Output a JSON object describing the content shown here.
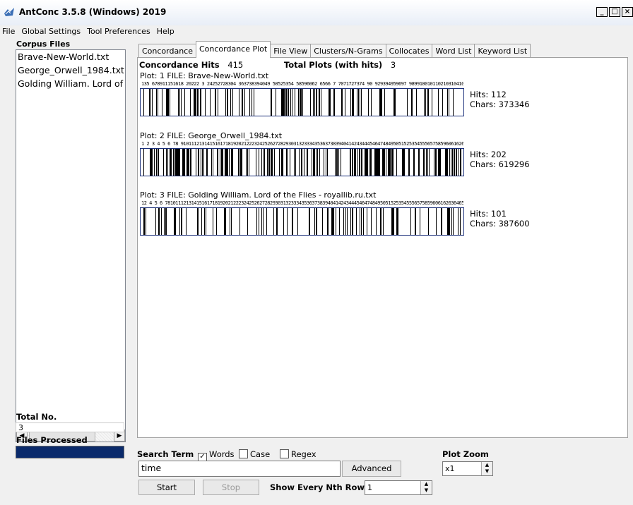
{
  "window": {
    "title": "AntConc 3.5.8 (Windows) 2019",
    "buttons": [
      "_",
      "□",
      "×"
    ]
  },
  "menu": [
    "File",
    "Global Settings",
    "Tool Preferences",
    "Help"
  ],
  "corpus": {
    "header": "Corpus Files",
    "files": [
      "Brave-New-World.txt",
      "George_Orwell_1984.txt",
      "Golding William. Lord of the Flies - royallib.ru.txt"
    ]
  },
  "totals": {
    "total_label": "Total No.",
    "total_value": "3",
    "files_processed_label": "Files Processed"
  },
  "tabs": [
    "Concordance",
    "Concordance Plot",
    "File View",
    "Clusters/N-Grams",
    "Collocates",
    "Word List",
    "Keyword List"
  ],
  "active_tab": "Concordance Plot",
  "summary": {
    "hits_label": "Concordance Hits",
    "hits_value": "415",
    "plots_label": "Total Plots (with hits)",
    "plots_value": "3"
  },
  "plots": [
    {
      "plot_label": "Plot: 1   FILE: Brave-New-World.txt",
      "numbers": "135 678911151618 20222 3 24252728304 363738394049 50525354 58596062 6566 7 7071727374 90 929394959697 9899100101102103104106108110112",
      "hits": "Hits: 112",
      "chars": "Chars: 373346",
      "hit_count": 112,
      "char_count": 373346,
      "seed": 7
    },
    {
      "plot_label": "Plot: 2   FILE: George_Orwell_1984.txt",
      "numbers": "1 2 3 4 5 6 78 910111213141516171819202122232425262728293031323334353637383940414243444546474849505152535455565758596061626364656667686970717273747576777879808182838485868788899091929394959697989910010110210310410510610710810911011111211311411511611711811912012112212312412512612712812913013113213313413513613713813914014114214314414514614714814915015115215315415515615715815916016116216316416516616716816917017117217317417517617717817918018118218318418518618718818919019119219319419519619719819920020120 2",
      "hits": "Hits: 202",
      "chars": "Chars: 619296",
      "hit_count": 202,
      "char_count": 619296,
      "seed": 13
    },
    {
      "plot_label": "Plot: 3   FILE: Golding William. Lord of the Flies - royallib.ru.txt",
      "numbers": "12 4 5   6     78101112131415161718192021222324252627282930313233343536373839404142434445464748495051525354555657585960616263646566676869707172737475767778798081828384858687888990919293949596979899100101",
      "hits": "Hits: 101",
      "chars": "Chars: 387600",
      "hit_count": 101,
      "char_count": 387600,
      "seed": 29
    }
  ],
  "controls": {
    "search_term_label": "Search Term",
    "words_label": "Words",
    "words_checked": true,
    "case_label": "Case",
    "case_checked": false,
    "regex_label": "Regex",
    "regex_checked": false,
    "search_value": "time",
    "advanced_label": "Advanced",
    "start_label": "Start",
    "stop_label": "Stop",
    "nth_row_label": "Show Every Nth Row",
    "nth_row_value": "1",
    "zoom_label": "Plot Zoom",
    "zoom_value": "x1"
  }
}
